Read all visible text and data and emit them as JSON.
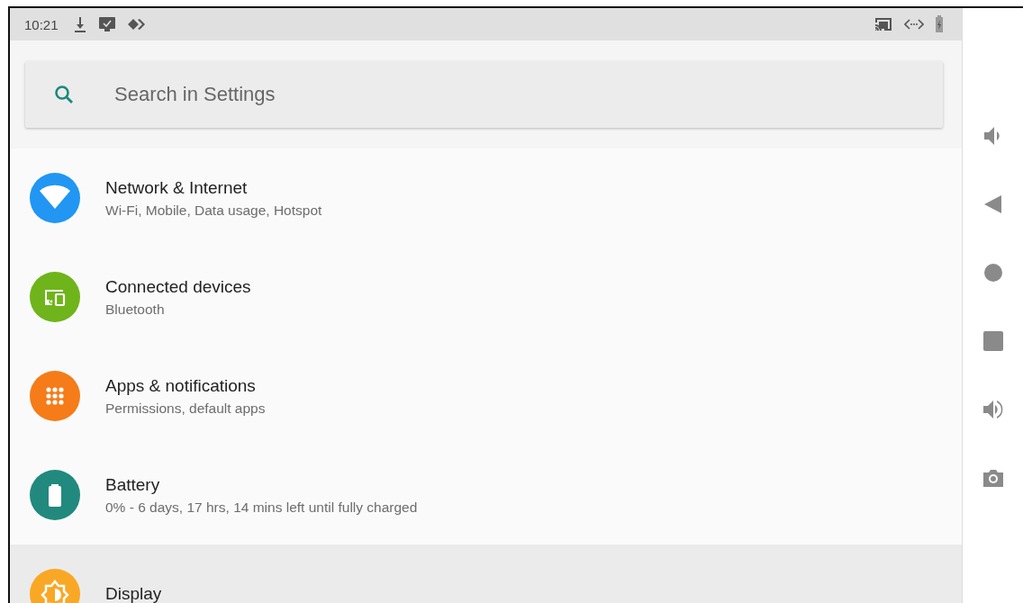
{
  "status_bar": {
    "time": "10:21"
  },
  "search": {
    "placeholder": "Search in Settings"
  },
  "settings": [
    {
      "kind": "network",
      "title": "Network & Internet",
      "subtitle": "Wi-Fi, Mobile, Data usage, Hotspot",
      "color": "#2196f3",
      "selected": false
    },
    {
      "kind": "devices",
      "title": "Connected devices",
      "subtitle": "Bluetooth",
      "color": "#6fb41a",
      "selected": false
    },
    {
      "kind": "apps",
      "title": "Apps & notifications",
      "subtitle": "Permissions, default apps",
      "color": "#f57c18",
      "selected": false
    },
    {
      "kind": "battery",
      "title": "Battery",
      "subtitle": "0% - 6 days, 17 hrs, 14 mins left until fully charged",
      "color": "#21897e",
      "selected": false
    },
    {
      "kind": "display",
      "title": "Display",
      "color": "#f9a825",
      "selected": true
    }
  ]
}
